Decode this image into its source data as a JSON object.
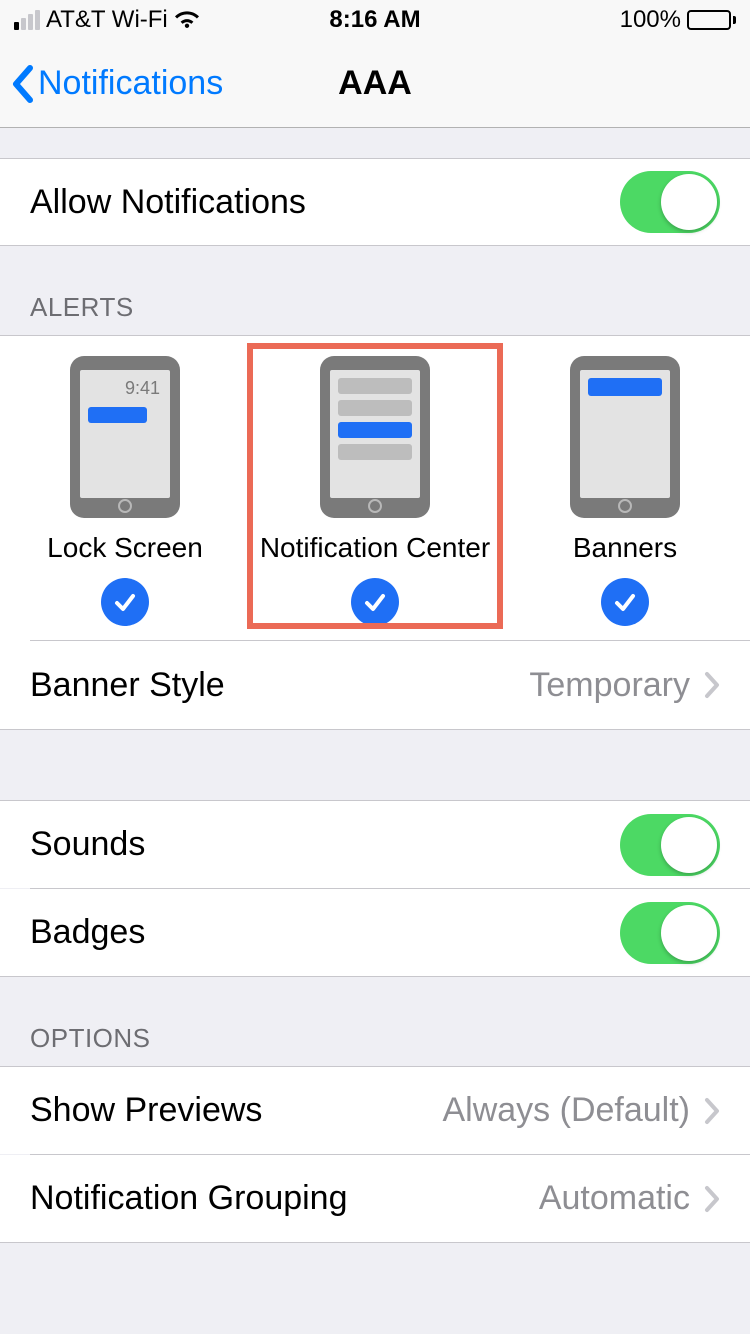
{
  "status": {
    "carrier": "AT&T Wi-Fi",
    "time": "8:16 AM",
    "battery_pct": "100%"
  },
  "nav": {
    "back_label": "Notifications",
    "title": "AAA"
  },
  "allow": {
    "label": "Allow Notifications",
    "on": true
  },
  "alerts_header": "ALERTS",
  "alerts": {
    "lock_screen": {
      "label": "Lock Screen",
      "time_sample": "9:41",
      "checked": true
    },
    "notification_center": {
      "label": "Notification Center",
      "checked": true,
      "highlighted": true
    },
    "banners": {
      "label": "Banners",
      "checked": true
    }
  },
  "banner_style": {
    "label": "Banner Style",
    "value": "Temporary"
  },
  "sounds": {
    "label": "Sounds",
    "on": true
  },
  "badges": {
    "label": "Badges",
    "on": true
  },
  "options_header": "OPTIONS",
  "show_previews": {
    "label": "Show Previews",
    "value": "Always (Default)"
  },
  "grouping": {
    "label": "Notification Grouping",
    "value": "Automatic"
  }
}
